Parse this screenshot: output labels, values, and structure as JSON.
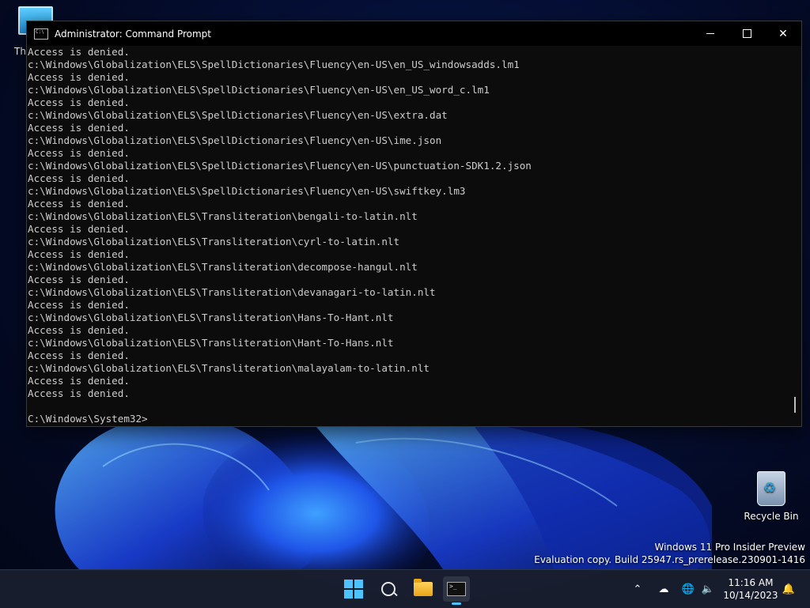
{
  "desktop": {
    "this_pc_label": "Th",
    "recycle_bin_label": "Recycle Bin",
    "watermark_line1": "Windows 11 Pro Insider Preview",
    "watermark_line2": "Evaluation copy. Build 25947.rs_prerelease.230901-1416"
  },
  "window": {
    "title": "Administrator: Command Prompt",
    "minimize_icon": "minimize-icon",
    "maximize_icon": "maximize-icon",
    "close_glyph": "✕"
  },
  "console": {
    "lines": [
      "Access is denied.",
      "c:\\Windows\\Globalization\\ELS\\SpellDictionaries\\Fluency\\en-US\\en_US_windowsadds.lm1",
      "Access is denied.",
      "c:\\Windows\\Globalization\\ELS\\SpellDictionaries\\Fluency\\en-US\\en_US_word_c.lm1",
      "Access is denied.",
      "c:\\Windows\\Globalization\\ELS\\SpellDictionaries\\Fluency\\en-US\\extra.dat",
      "Access is denied.",
      "c:\\Windows\\Globalization\\ELS\\SpellDictionaries\\Fluency\\en-US\\ime.json",
      "Access is denied.",
      "c:\\Windows\\Globalization\\ELS\\SpellDictionaries\\Fluency\\en-US\\punctuation-SDK1.2.json",
      "Access is denied.",
      "c:\\Windows\\Globalization\\ELS\\SpellDictionaries\\Fluency\\en-US\\swiftkey.lm3",
      "Access is denied.",
      "c:\\Windows\\Globalization\\ELS\\Transliteration\\bengali-to-latin.nlt",
      "Access is denied.",
      "c:\\Windows\\Globalization\\ELS\\Transliteration\\cyrl-to-latin.nlt",
      "Access is denied.",
      "c:\\Windows\\Globalization\\ELS\\Transliteration\\decompose-hangul.nlt",
      "Access is denied.",
      "c:\\Windows\\Globalization\\ELS\\Transliteration\\devanagari-to-latin.nlt",
      "Access is denied.",
      "c:\\Windows\\Globalization\\ELS\\Transliteration\\Hans-To-Hant.nlt",
      "Access is denied.",
      "c:\\Windows\\Globalization\\ELS\\Transliteration\\Hant-To-Hans.nlt",
      "Access is denied.",
      "c:\\Windows\\Globalization\\ELS\\Transliteration\\malayalam-to-latin.nlt",
      "Access is denied.",
      "Access is denied.",
      "",
      "C:\\Windows\\System32>"
    ]
  },
  "taskbar": {
    "start_icon": "windows-start-icon",
    "search_icon": "search-icon",
    "explorer_icon": "file-explorer-icon",
    "cmd_icon": "command-prompt-icon",
    "chevron_glyph": "⌃",
    "cloud_glyph": "☁",
    "globe_glyph": "🌐",
    "speaker_glyph": "🔈",
    "bell_glyph": "🔔",
    "time": "11:16 AM",
    "date": "10/14/2023"
  },
  "colors": {
    "console_bg": "#0c0c0c",
    "console_text": "#cccccc",
    "accent": "#4cc2ff"
  }
}
